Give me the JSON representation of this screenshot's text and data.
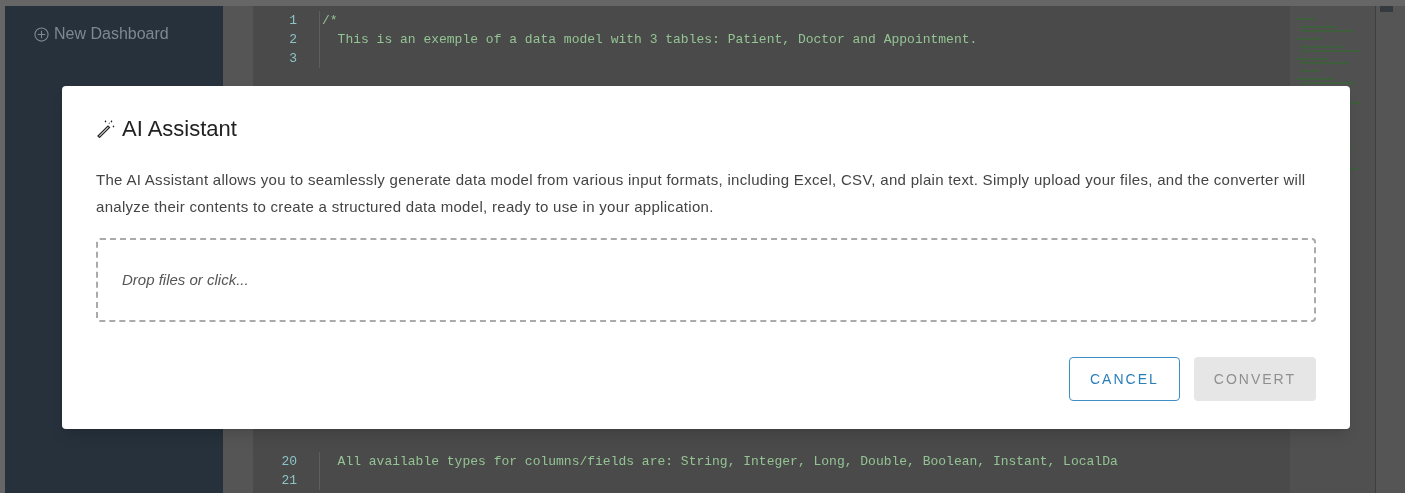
{
  "sidebar": {
    "new_dashboard": "New Dashboard"
  },
  "editor": {
    "top_lines": [
      {
        "number": "1",
        "text": "/*"
      },
      {
        "number": "2",
        "text": "  This is an exemple of a data model with 3 tables: Patient, Doctor and Appointment."
      },
      {
        "number": "3"
      }
    ],
    "bottom_lines": [
      {
        "number": "20",
        "text": "  All available types for columns/fields are: String, Integer, Long, Double, Boolean, Instant, LocalDa"
      },
      {
        "number": "21"
      }
    ]
  },
  "dialog": {
    "title": "AI Assistant",
    "description": "The AI Assistant allows you to seamlessly generate data model from various input formats, including Excel, CSV, and plain text. Simply upload your files, and the converter will analyze their contents to create a structured data model, ready to use in your application.",
    "dropzone": {
      "placeholder": "Drop files or click..."
    },
    "buttons": [
      {
        "label": "CANCEL",
        "disabled": false
      },
      {
        "label": "CONVERT",
        "disabled": true
      }
    ]
  }
}
